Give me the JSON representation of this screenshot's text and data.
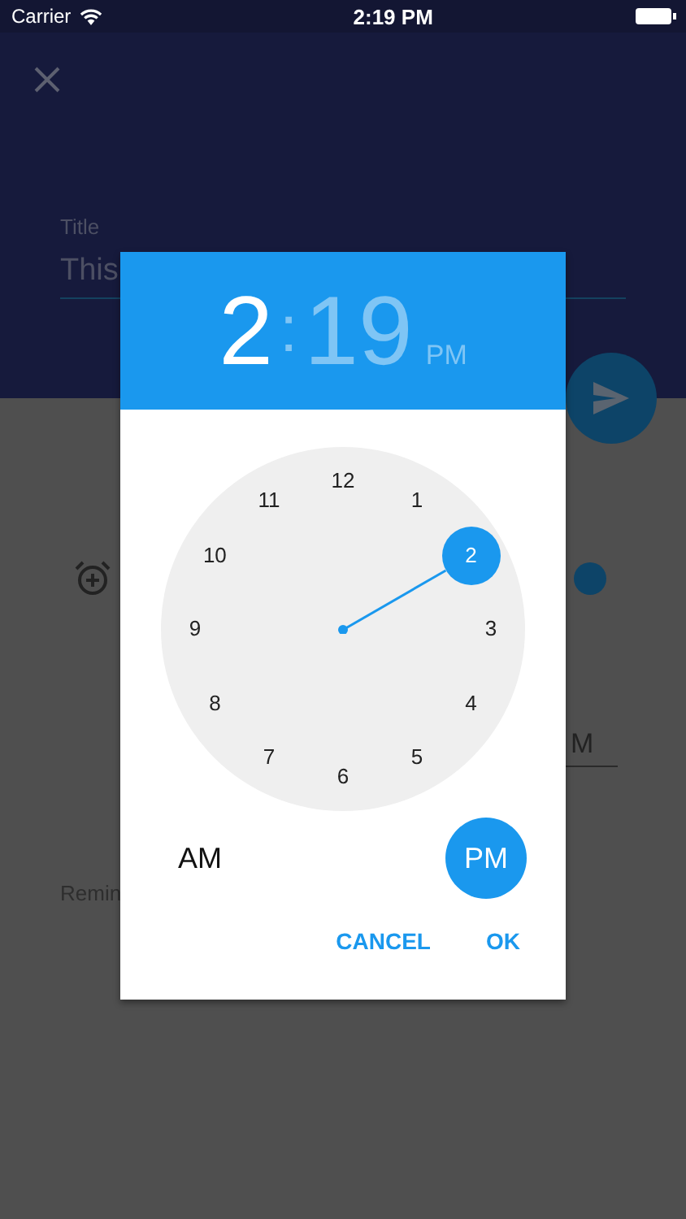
{
  "status_bar": {
    "carrier": "Carrier",
    "time": "2:19 PM"
  },
  "background": {
    "title_label": "Title",
    "title_value": "This",
    "time_fragment": "M",
    "reminder_fragment": "Remin"
  },
  "time_picker": {
    "hour": "2",
    "separator": ":",
    "minute": "19",
    "period": "PM",
    "hours": [
      {
        "label": "12",
        "selected": false
      },
      {
        "label": "1",
        "selected": false
      },
      {
        "label": "2",
        "selected": true
      },
      {
        "label": "3",
        "selected": false
      },
      {
        "label": "4",
        "selected": false
      },
      {
        "label": "5",
        "selected": false
      },
      {
        "label": "6",
        "selected": false
      },
      {
        "label": "7",
        "selected": false
      },
      {
        "label": "8",
        "selected": false
      },
      {
        "label": "9",
        "selected": false
      },
      {
        "label": "10",
        "selected": false
      },
      {
        "label": "11",
        "selected": false
      }
    ],
    "periods": [
      {
        "label": "AM",
        "selected": false
      },
      {
        "label": "PM",
        "selected": true
      }
    ],
    "buttons": [
      "CANCEL",
      "OK"
    ]
  }
}
